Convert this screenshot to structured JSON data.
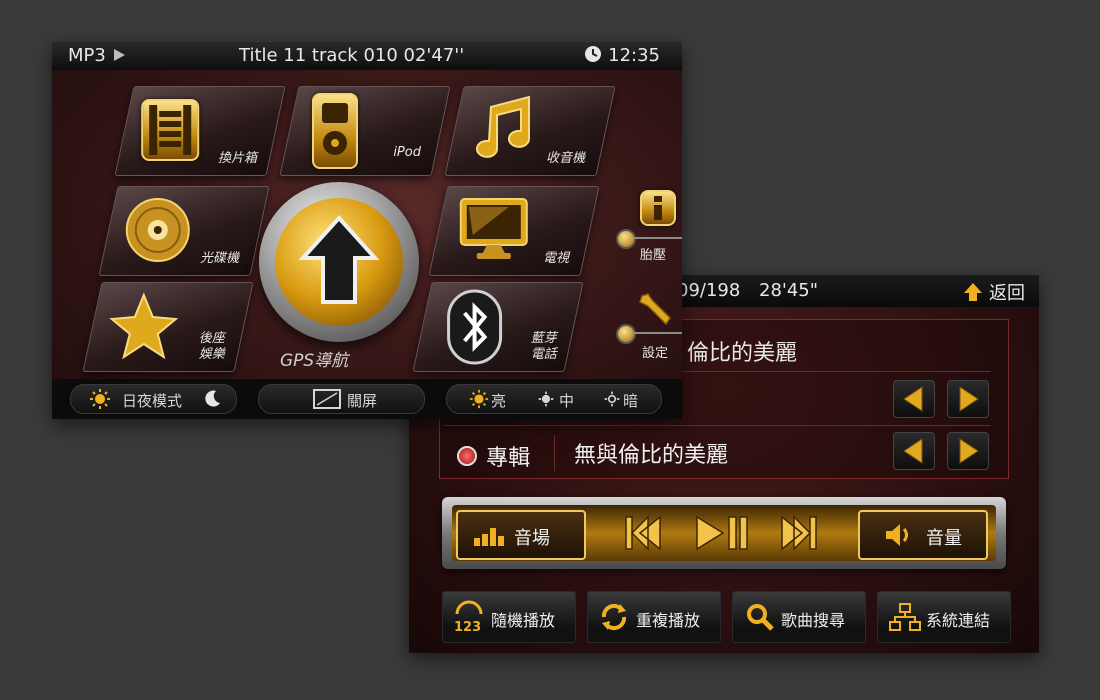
{
  "front": {
    "status": {
      "mode": "MP3",
      "track_info": "Title 11 track 010 02'47''",
      "clock": "12:35"
    },
    "tiles": [
      {
        "label": "換片箱",
        "icon": "film-strip-icon"
      },
      {
        "label": "iPod",
        "icon": "ipod-icon"
      },
      {
        "label": "收音機",
        "icon": "music-note-icon"
      },
      {
        "label": "光碟機",
        "icon": "disc-icon"
      },
      {
        "label": "電視",
        "icon": "tv-monitor-icon"
      },
      {
        "label": "後座\n娛樂",
        "icon": "star-icon"
      },
      {
        "label": "藍芽\n電話",
        "icon": "bluetooth-icon"
      }
    ],
    "gps_label": "GPS導航",
    "side": {
      "tire_label": "胎壓",
      "settings_label": "設定"
    },
    "bottom": {
      "day_night": "日夜模式",
      "screen_off": "關屏",
      "bright": "亮",
      "mid": "中",
      "dark": "暗"
    }
  },
  "back": {
    "top": {
      "partial_track": "09/198",
      "time": "28'45\"",
      "back_label": "返回"
    },
    "row1_text": "倫比的美麗",
    "row3": {
      "category": "專輯",
      "value": "無與倫比的美麗"
    },
    "transport": {
      "sound_field": "音場",
      "volume": "音量"
    },
    "functions": [
      {
        "label": "隨機播放",
        "icon": "shuffle-123-icon"
      },
      {
        "label": "重複播放",
        "icon": "repeat-icon"
      },
      {
        "label": "歌曲搜尋",
        "icon": "search-icon"
      },
      {
        "label": "系統連結",
        "icon": "network-icon"
      }
    ]
  },
  "colors": {
    "gold": "#e0a81c",
    "dark_red": "#3a1818"
  }
}
